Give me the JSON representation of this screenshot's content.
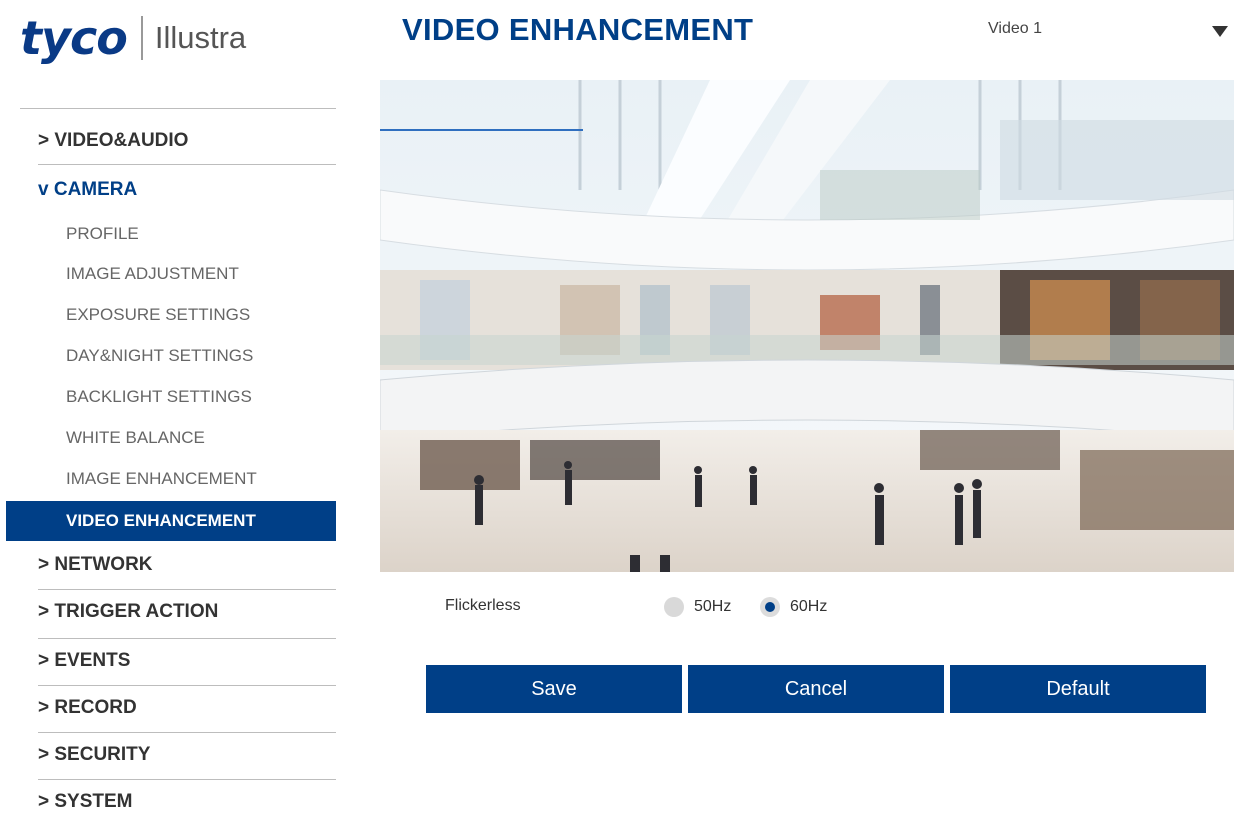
{
  "brand": {
    "name": "tyco",
    "product": "Illustra"
  },
  "sidebar": {
    "items": [
      {
        "label": "> VIDEO&AUDIO"
      },
      {
        "label": "v CAMERA"
      },
      {
        "label": "> NETWORK"
      },
      {
        "label": "> TRIGGER ACTION"
      },
      {
        "label": "> EVENTS"
      },
      {
        "label": "> RECORD"
      },
      {
        "label": "> SECURITY"
      },
      {
        "label": "> SYSTEM"
      }
    ],
    "camera_subitems": [
      {
        "label": "PROFILE"
      },
      {
        "label": "IMAGE ADJUSTMENT"
      },
      {
        "label": "EXPOSURE SETTINGS"
      },
      {
        "label": "DAY&NIGHT SETTINGS"
      },
      {
        "label": "BACKLIGHT SETTINGS"
      },
      {
        "label": "WHITE BALANCE"
      },
      {
        "label": "IMAGE ENHANCEMENT"
      },
      {
        "label": "VIDEO ENHANCEMENT",
        "active": true
      }
    ]
  },
  "header": {
    "title": "VIDEO ENHANCEMENT",
    "stream_select": {
      "value": "Video 1",
      "icon": "triangle-down-icon"
    }
  },
  "video_preview": {
    "content": "camera-live-view"
  },
  "flickerless": {
    "label": "Flickerless",
    "options": [
      {
        "label": "50Hz",
        "selected": false
      },
      {
        "label": "60Hz",
        "selected": true
      }
    ]
  },
  "buttons": {
    "save": "Save",
    "cancel": "Cancel",
    "default": "Default"
  },
  "colors": {
    "accent": "#003f87",
    "separator": "#bdbdbd",
    "radio_unselected": "#d9d9d9"
  }
}
